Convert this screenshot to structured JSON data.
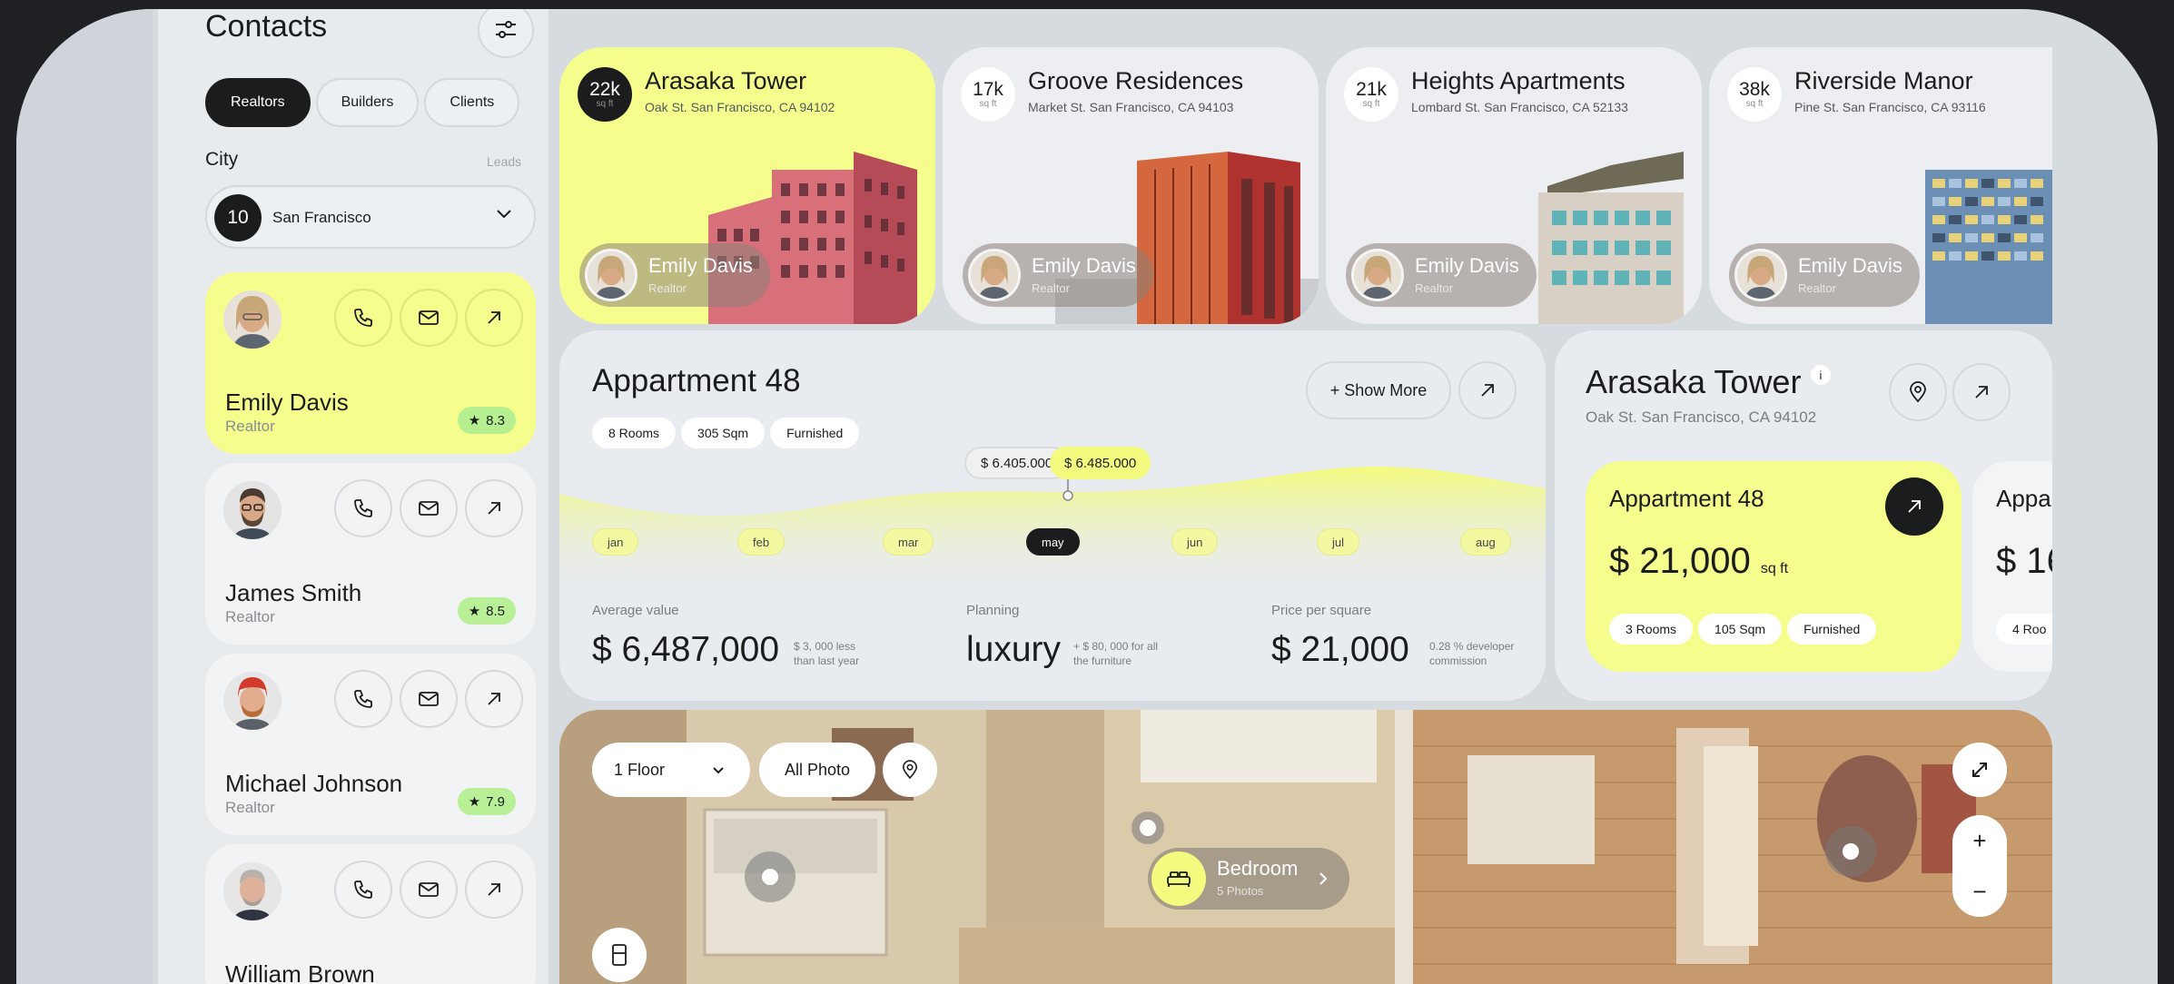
{
  "sidebar": {
    "title": "Contacts",
    "segments": [
      "Realtors",
      "Builders",
      "Clients"
    ],
    "city_label": "City",
    "leads_label": "Leads",
    "city_count": "10",
    "city_value": "San Francisco",
    "contacts": [
      {
        "name": "Emily Davis",
        "role": "Realtor",
        "rating": "8.3"
      },
      {
        "name": "James Smith",
        "role": "Realtor",
        "rating": "8.5"
      },
      {
        "name": "Michael Johnson",
        "role": "Realtor",
        "rating": "7.9"
      },
      {
        "name": "William Brown",
        "role": "",
        "rating": ""
      }
    ]
  },
  "properties": [
    {
      "sqft": "22k",
      "unit": "sq ft",
      "title": "Arasaka Tower",
      "address": "Oak St. San Francisco, CA 94102",
      "agent": "Emily Davis",
      "agent_role": "Realtor"
    },
    {
      "sqft": "17k",
      "unit": "sq ft",
      "title": "Groove Residences",
      "address": "Market St. San Francisco, CA 94103",
      "agent": "Emily Davis",
      "agent_role": "Realtor"
    },
    {
      "sqft": "21k",
      "unit": "sq ft",
      "title": "Heights Apartments",
      "address": "Lombard St. San Francisco, CA 52133",
      "agent": "Emily Davis",
      "agent_role": "Realtor"
    },
    {
      "sqft": "38k",
      "unit": "sq ft",
      "title": "Riverside Manor",
      "address": "Pine St. San Francisco, CA 93116",
      "agent": "Emily Davis",
      "agent_role": "Realtor"
    }
  ],
  "apartment": {
    "title": "Appartment 48",
    "tags": [
      "8 Rooms",
      "305 Sqm",
      "Furnished"
    ],
    "show_more": "+ Show More",
    "price_prev": "$ 6.405.000",
    "price_cur": "$ 6.485.000",
    "months": [
      "jan",
      "feb",
      "mar",
      "may",
      "jun",
      "jul",
      "aug"
    ],
    "active_month": "may",
    "stats": [
      {
        "label": "Average value",
        "value": "$ 6,487,000",
        "note": "$ 3, 000 less than last year"
      },
      {
        "label": "Planning",
        "value": "luxury",
        "note": "+ $ 80, 000 for all the furniture"
      },
      {
        "label": "Price per square",
        "value": "$ 21,000",
        "note": "0.28 % developer commission"
      }
    ]
  },
  "detail": {
    "title": "Arasaka Tower",
    "info": "i",
    "address": "Oak St. San Francisco, CA 94102",
    "card": {
      "title": "Appartment 48",
      "price": "$ 21,000",
      "unit": "sq ft",
      "tags": [
        "3 Rooms",
        "105 Sqm",
        "Furnished"
      ]
    },
    "card2": {
      "title": "Appa",
      "price": "$ 16",
      "tag": "4 Roo"
    }
  },
  "floorplan": {
    "floor": "1 Floor",
    "photo_btn": "All Photo",
    "room": {
      "name": "Bedroom",
      "photos": "5 Photos"
    },
    "zoom_in": "+",
    "zoom_out": "−"
  },
  "colors": {
    "accent": "#f5fd8d",
    "dark": "#1b1c1e",
    "rating": "#b9ef96"
  }
}
